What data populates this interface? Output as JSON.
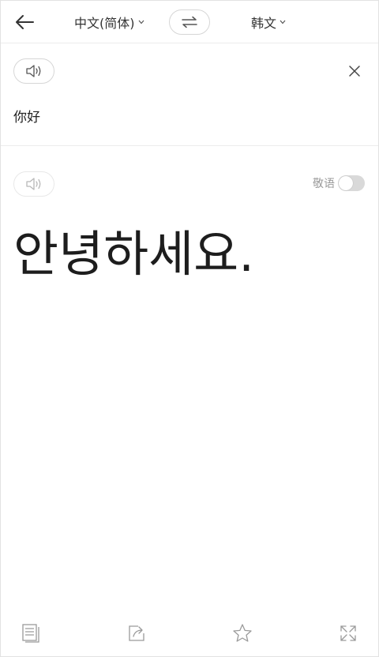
{
  "header": {
    "source_lang": "中文(简体)",
    "target_lang": "韩文"
  },
  "icons": {
    "back": "arrow-left-icon",
    "swap": "swap-arrows-icon",
    "speaker": "speaker-icon",
    "close": "close-icon",
    "copy": "copy-icon",
    "share": "share-icon",
    "star": "star-icon",
    "fullscreen": "expand-icon"
  },
  "source": {
    "text": "你好"
  },
  "target": {
    "honorific_label": "敬语",
    "honorific_on": false,
    "text": "안녕하세요."
  },
  "colors": {
    "text": "#222222",
    "muted": "#9a9a9a",
    "border": "#d6d6d6",
    "toggle_off": "#d9d9d9"
  }
}
